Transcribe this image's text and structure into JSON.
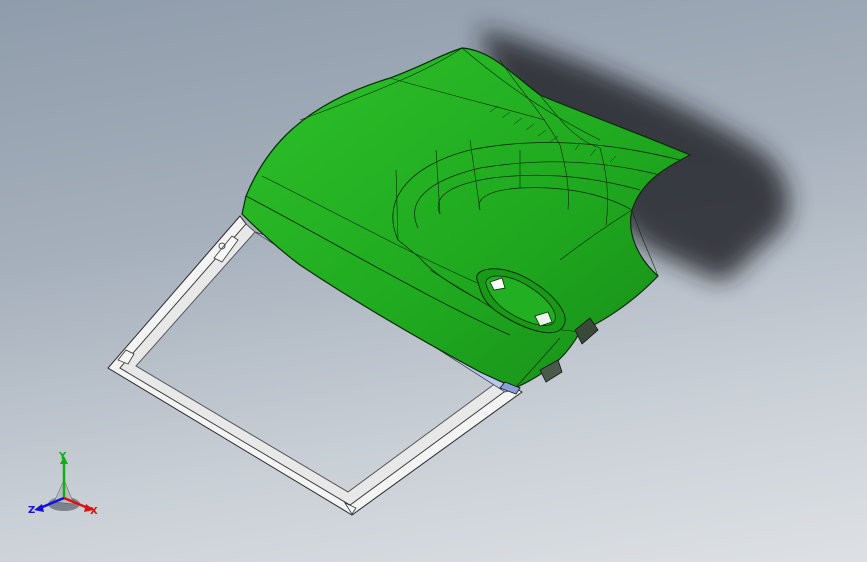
{
  "viewport": {
    "background_top": "#8f9cab",
    "background_bottom": "#dde1e5"
  },
  "model": {
    "part_color": "#1fa81f",
    "edge_color": "#0a2a0a",
    "frame_color": "#f4f4f4",
    "shadow_color": "#1c1f24"
  },
  "triad": {
    "x_label": "X",
    "y_label": "Y",
    "z_label": "Z",
    "x_color": "#e01010",
    "y_color": "#10b010",
    "z_color": "#1010e0"
  }
}
